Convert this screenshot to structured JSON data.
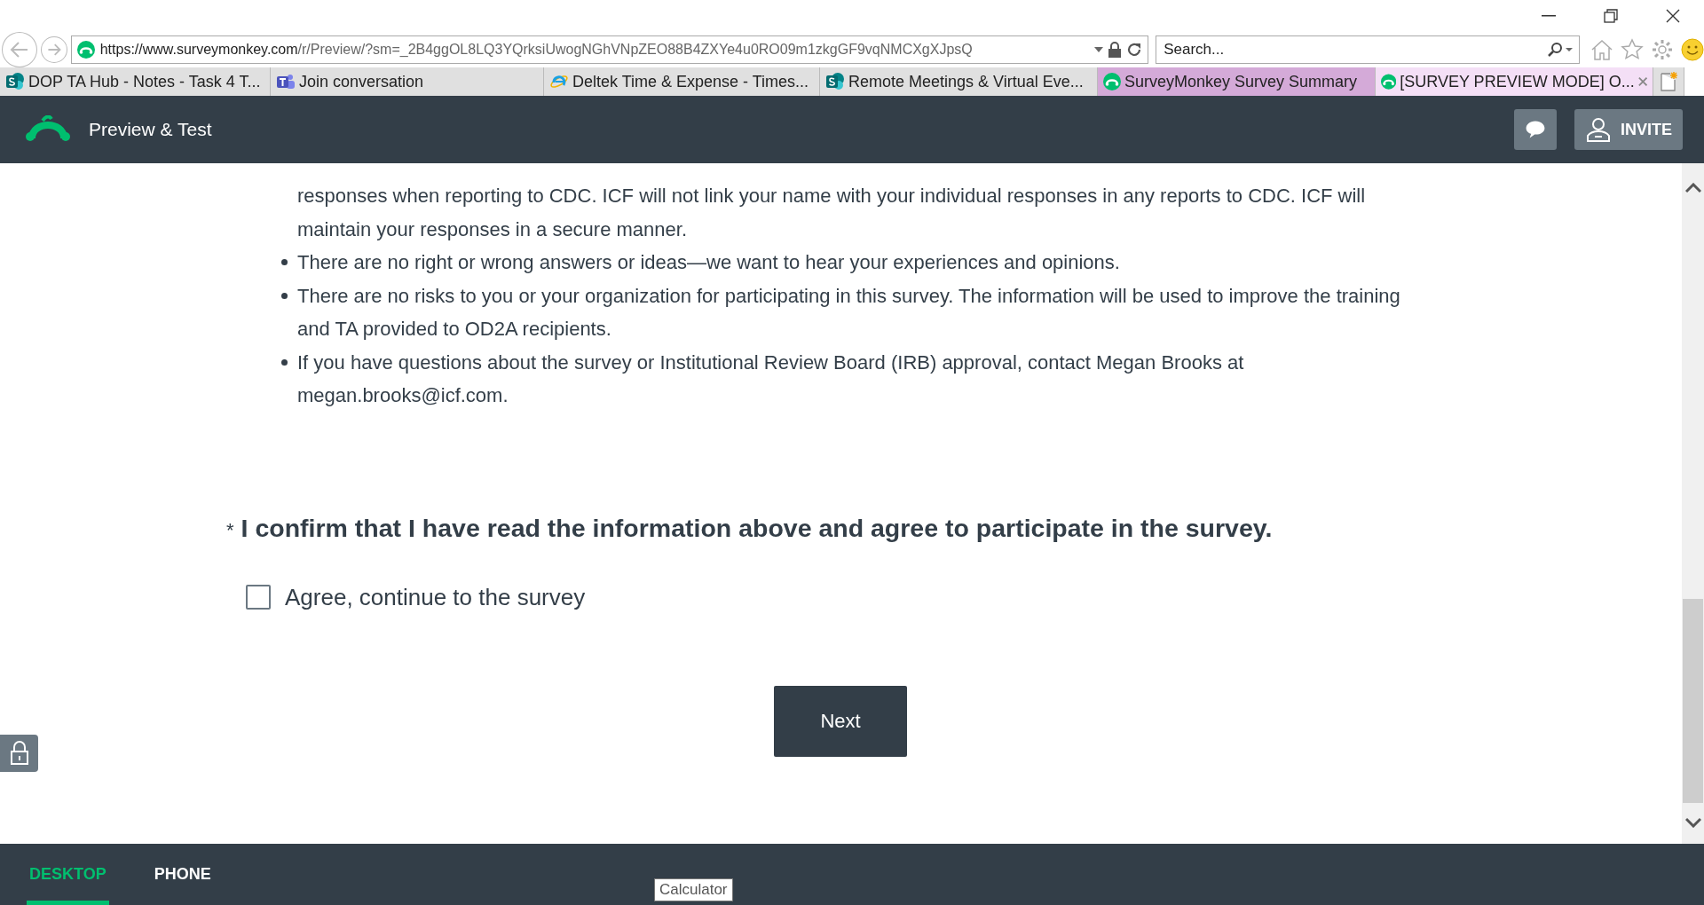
{
  "browser": {
    "url_parts": [
      "https://www.",
      "surveymonkey.com",
      "/r/Preview/?sm=_2B4ggOL8LQ3YQrksiUwogNGhVNpZEO88B4ZXYe4u0RO09m1zkgGF9vqNMCXgXJpsQ"
    ],
    "search": {
      "placeholder": "Search..."
    },
    "tabs": [
      {
        "label": "DOP TA Hub - Notes - Task 4 T...",
        "kind": "sharepoint",
        "selected": false,
        "color": "#e0e0e0"
      },
      {
        "label": "Join conversation",
        "kind": "teams",
        "selected": false,
        "color": "#e0e0e0"
      },
      {
        "label": "Deltek Time & Expense - Times...",
        "kind": "ie",
        "selected": false,
        "color": "#e0e0e0"
      },
      {
        "label": "Remote Meetings & Virtual Eve...",
        "kind": "sharepoint",
        "selected": false,
        "color": "#e0e0e0"
      },
      {
        "label": "SurveyMonkey Survey Summary",
        "kind": "monkey",
        "selected": false,
        "color": "#d4aad8"
      },
      {
        "label": "[SURVEY PREVIEW MODE] O...",
        "kind": "monkey",
        "selected": true,
        "color": "#f4dff6"
      }
    ]
  },
  "header": {
    "title": "Preview & Test",
    "invite": "INVITE"
  },
  "content": {
    "paragraphs": [
      {
        "bullet": false,
        "text": "responses when reporting to CDC. ICF will not link your name with your individual responses in any reports to CDC. ICF will maintain your responses in a secure manner."
      },
      {
        "bullet": true,
        "text": "There are no right or wrong answers or ideas—we want to hear your experiences and opinions."
      },
      {
        "bullet": true,
        "text": "There are no risks to you or your organization for participating in this survey. The information will be used to improve the training and TA provided to OD2A recipients."
      },
      {
        "bullet": true,
        "text": "If you have questions about the survey or Institutional Review Board (IRB) approval, contact Megan Brooks at megan.brooks@icf.com."
      }
    ],
    "question": {
      "required_mark": "*",
      "text": "I confirm that I have read the information above and agree to participate in the survey."
    },
    "option": {
      "label": "Agree, continue to the survey",
      "checked": false
    },
    "next": "Next"
  },
  "footer": {
    "tabs": [
      {
        "label": "DESKTOP",
        "selected": true
      },
      {
        "label": "PHONE",
        "selected": false
      }
    ],
    "tooltip": "Calculator"
  }
}
